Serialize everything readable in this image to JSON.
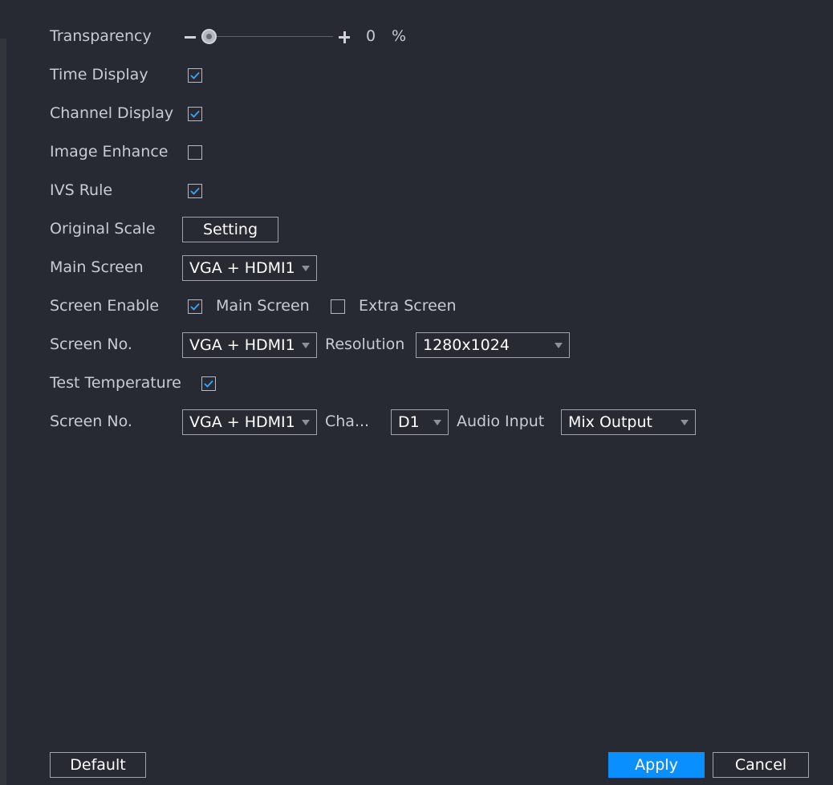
{
  "transparency": {
    "label": "Transparency",
    "value": "0",
    "unit": "%"
  },
  "time_display": {
    "label": "Time Display",
    "checked": true
  },
  "channel_display": {
    "label": "Channel Display",
    "checked": true
  },
  "image_enhance": {
    "label": "Image Enhance",
    "checked": false
  },
  "ivs_rule": {
    "label": "IVS Rule",
    "checked": true
  },
  "original_scale": {
    "label": "Original Scale",
    "button": "Setting"
  },
  "main_screen": {
    "label": "Main Screen",
    "value": "VGA + HDMI1"
  },
  "screen_enable": {
    "label": "Screen Enable",
    "main": {
      "label": "Main Screen",
      "checked": true
    },
    "extra": {
      "label": "Extra Screen",
      "checked": false
    }
  },
  "screen_row1": {
    "label": "Screen No.",
    "value": "VGA + HDMI1",
    "resolution_label": "Resolution",
    "resolution_value": "1280x1024"
  },
  "test_temperature": {
    "label": "Test Temperature",
    "checked": true
  },
  "screen_row2": {
    "label": "Screen No.",
    "value": "VGA + HDMI1",
    "channel_label": "Cha...",
    "channel_value": "D1",
    "audio_label": "Audio Input",
    "audio_value": "Mix Output"
  },
  "footer": {
    "default": "Default",
    "apply": "Apply",
    "cancel": "Cancel"
  },
  "colors": {
    "background": "#282a33",
    "accent": "#0a8fff",
    "check": "#3aa6ff"
  }
}
